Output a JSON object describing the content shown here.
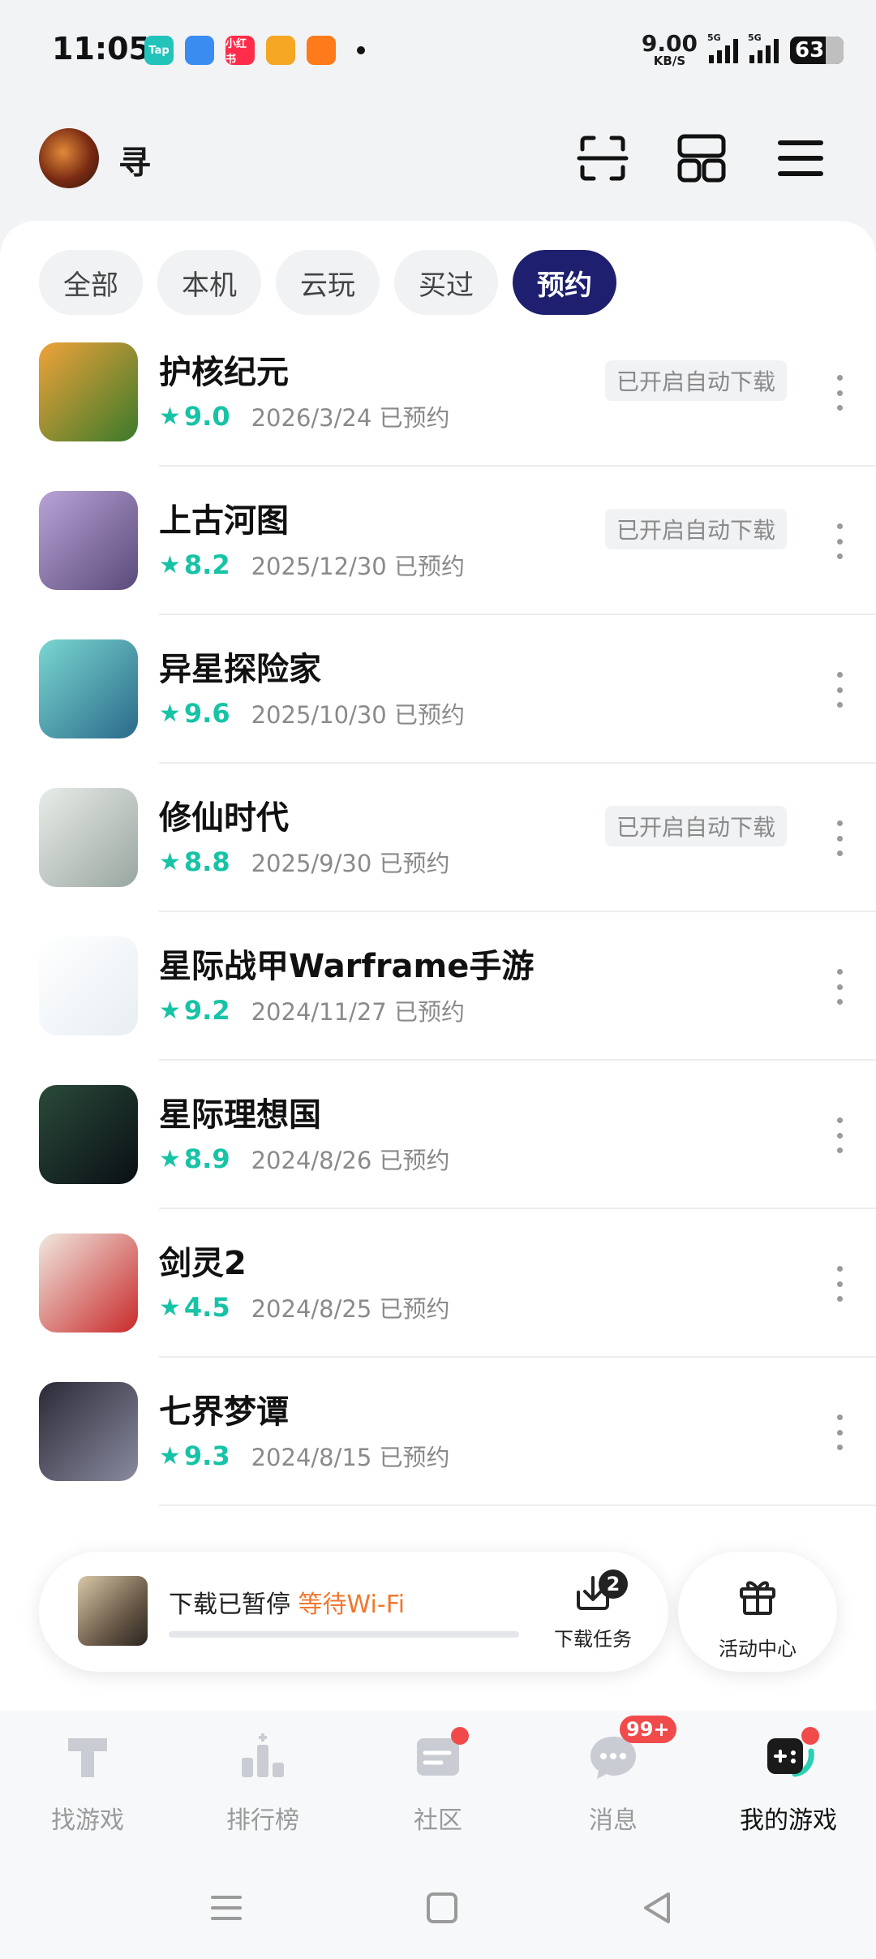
{
  "status_bar": {
    "time": "11:05",
    "app_icons": [
      {
        "name": "taptap-icon",
        "label": "Tap",
        "color": "#22c3b9"
      },
      {
        "name": "browser-icon",
        "label": "",
        "color": "#3a8cf0"
      },
      {
        "name": "xiaohongshu-icon",
        "label": "小红书",
        "color": "#ff2d4a"
      },
      {
        "name": "weibo-icon",
        "label": "",
        "color": "#f5a623"
      },
      {
        "name": "app-icon",
        "label": "",
        "color": "#ff7a1a"
      }
    ],
    "net_speed": "9.00",
    "net_unit": "KB/S",
    "signal_tag": "5G",
    "battery": "63"
  },
  "header": {
    "username": "寻",
    "icons": [
      "scan-icon",
      "layout-icon",
      "menu-icon"
    ]
  },
  "tabs": [
    {
      "label": "全部",
      "active": false
    },
    {
      "label": "本机",
      "active": false
    },
    {
      "label": "云玩",
      "active": false
    },
    {
      "label": "买过",
      "active": false
    },
    {
      "label": "预约",
      "active": true
    }
  ],
  "games": [
    {
      "name": "护核纪元",
      "score": "9.0",
      "date": "2026/3/24 已预约",
      "auto_download": "已开启自动下载",
      "colors": [
        "#f0a23a",
        "#3a7a2a"
      ]
    },
    {
      "name": "上古河图",
      "score": "8.2",
      "date": "2025/12/30 已预约",
      "auto_download": "已开启自动下载",
      "colors": [
        "#b9a3d6",
        "#5a4a7a"
      ]
    },
    {
      "name": "异星探险家",
      "score": "9.6",
      "date": "2025/10/30 已预约",
      "auto_download": "",
      "colors": [
        "#7ad6d0",
        "#2a6a8a"
      ]
    },
    {
      "name": "修仙时代",
      "score": "8.8",
      "date": "2025/9/30 已预约",
      "auto_download": "已开启自动下载",
      "colors": [
        "#e8ece8",
        "#9aa6a0"
      ]
    },
    {
      "name": "星际战甲Warframe手游",
      "score": "9.2",
      "date": "2024/11/27 已预约",
      "auto_download": "",
      "colors": [
        "#ffffff",
        "#e8eef2"
      ]
    },
    {
      "name": "星际理想国",
      "score": "8.9",
      "date": "2024/8/26 已预约",
      "auto_download": "",
      "colors": [
        "#2a4a3a",
        "#0a0f14"
      ]
    },
    {
      "name": "剑灵2",
      "score": "4.5",
      "date": "2024/8/25 已预约",
      "auto_download": "",
      "colors": [
        "#f0e8e0",
        "#c82a2a"
      ]
    },
    {
      "name": "七界梦谭",
      "score": "9.3",
      "date": "2024/8/15 已预约",
      "auto_download": "",
      "colors": [
        "#2a2a36",
        "#8a8aa0"
      ]
    }
  ],
  "download": {
    "status": "下载已暂停",
    "waiting": "等待Wi-Fi",
    "task_label": "下载任务",
    "task_count": "2",
    "activity_label": "活动中心"
  },
  "bottom_nav": [
    {
      "label": "找游戏",
      "icon": "find-game-icon",
      "active": false
    },
    {
      "label": "排行榜",
      "icon": "ranking-icon",
      "active": false
    },
    {
      "label": "社区",
      "icon": "community-icon",
      "active": false
    },
    {
      "label": "消息",
      "icon": "message-icon",
      "active": false,
      "badge": "99+"
    },
    {
      "label": "我的游戏",
      "icon": "my-games-icon",
      "active": true
    }
  ]
}
